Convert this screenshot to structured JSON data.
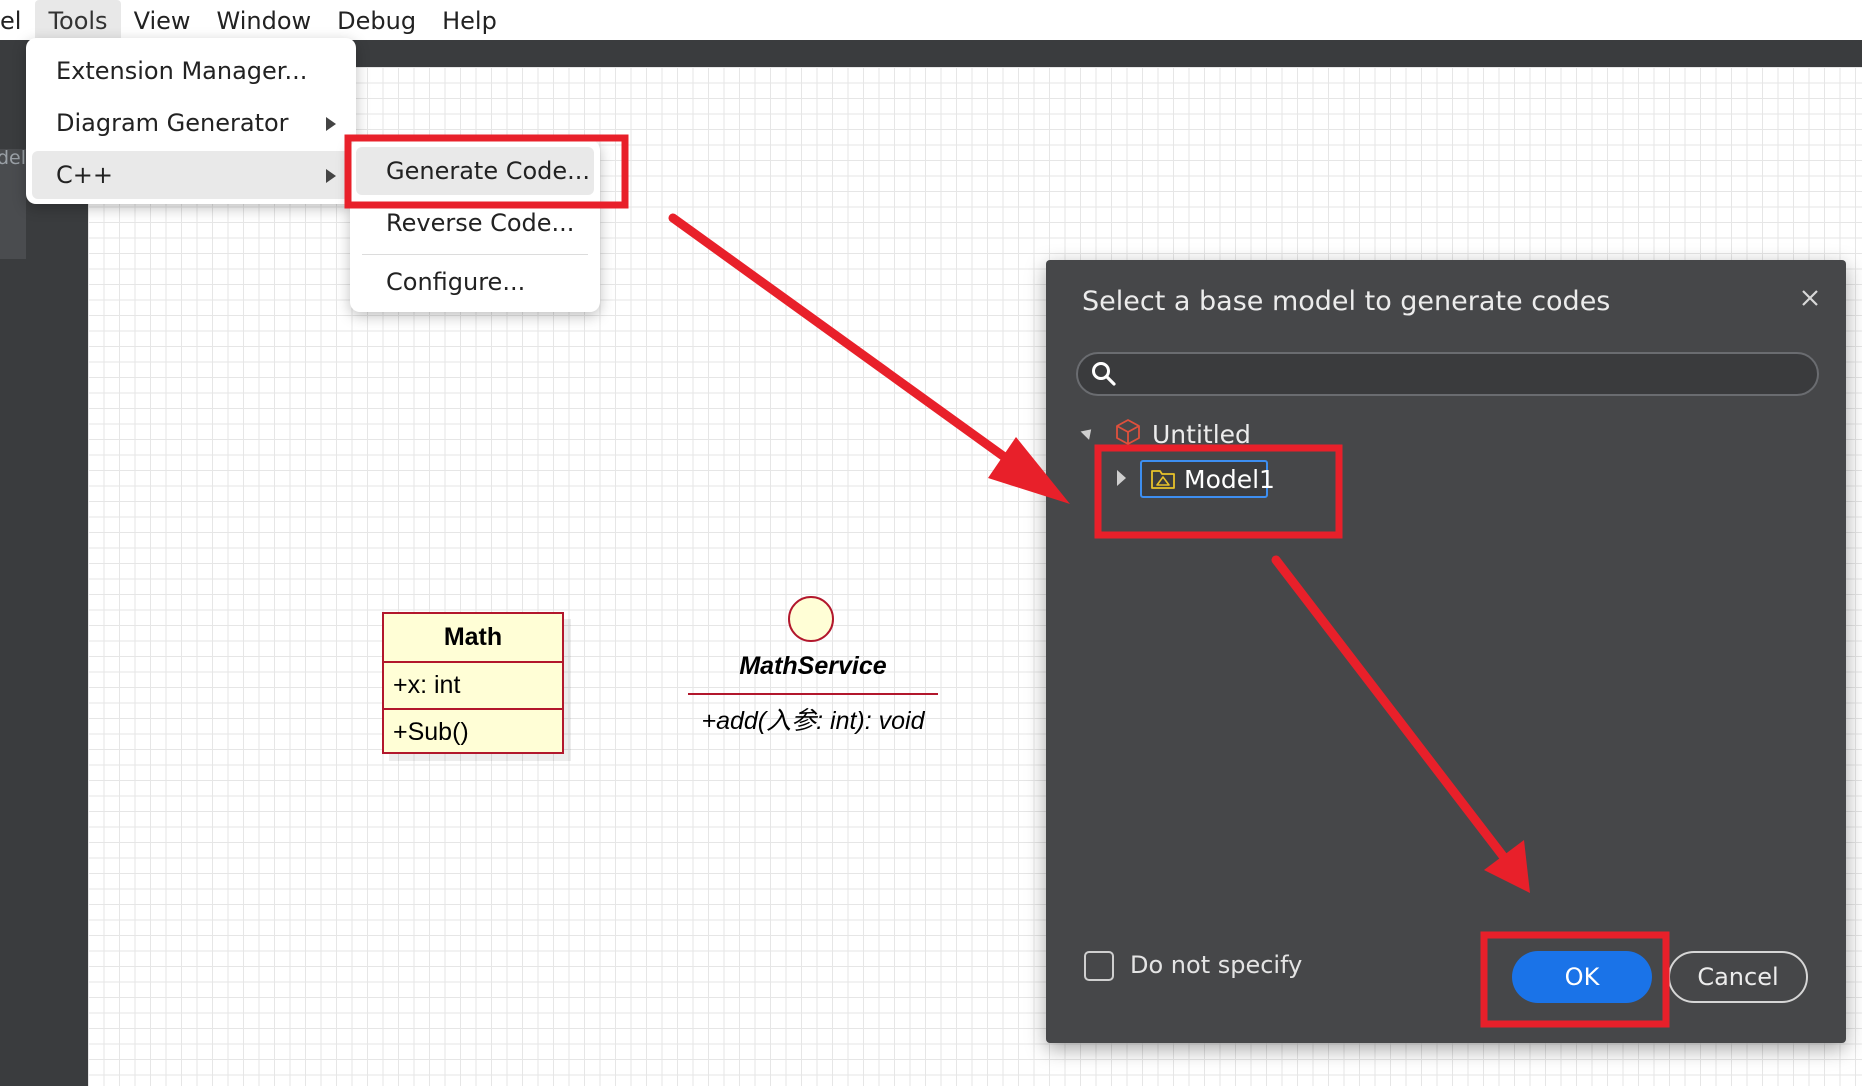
{
  "menubar": {
    "items": [
      "el",
      "Tools",
      "View",
      "Window",
      "Debug",
      "Help"
    ]
  },
  "sidebar": {
    "tab_text": "del"
  },
  "tools_menu": {
    "items": [
      {
        "label": "Extension Manager..."
      },
      {
        "label": "Diagram Generator"
      },
      {
        "label": "C++"
      }
    ]
  },
  "cpp_submenu": {
    "items": [
      {
        "label": "Generate Code..."
      },
      {
        "label": "Reverse Code..."
      },
      {
        "label": "Configure..."
      }
    ]
  },
  "diagram": {
    "class": {
      "name": "Math",
      "attribute": "+x: int",
      "operation": "+Sub()"
    },
    "interface": {
      "name": "MathService",
      "operation": "+add(入参: int): void"
    }
  },
  "dialog": {
    "title": "Select a base model to generate codes",
    "search_value": "",
    "tree": {
      "root": "Untitled",
      "child": "Model1"
    },
    "checkbox_label": "Do not specify",
    "checkbox_checked": false,
    "ok_label": "OK",
    "cancel_label": "Cancel"
  },
  "annotation_color": "#e8202a",
  "icons": {
    "search": "search-icon",
    "close": "close-icon",
    "project": "project-icon",
    "model": "model-folder-icon"
  }
}
